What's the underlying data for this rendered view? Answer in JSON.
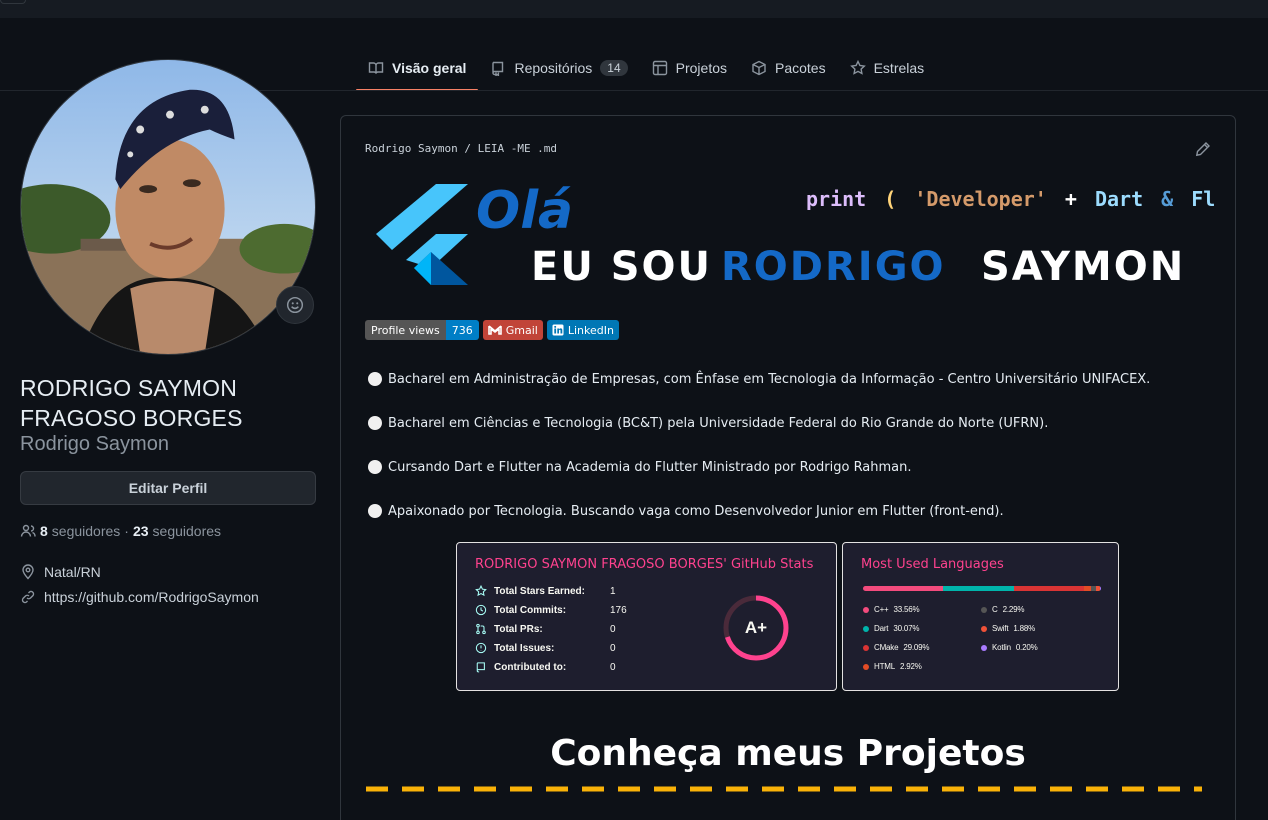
{
  "tabs": [
    {
      "label": "Visão geral",
      "active": true
    },
    {
      "label": "Repositórios",
      "count": "14"
    },
    {
      "label": "Projetos"
    },
    {
      "label": "Pacotes"
    },
    {
      "label": "Estrelas"
    }
  ],
  "profile": {
    "fullname": "RODRIGO SAYMON FRAGOSO BORGES",
    "username": "Rodrigo Saymon",
    "edit_button": "Editar Perfil",
    "followers_count": "8",
    "followers_label": "seguidores",
    "separator": "·",
    "following_count": "23",
    "following_label": "seguidores",
    "location": "Natal/RN",
    "website": "https://github.com/RodrigoSaymon"
  },
  "readme": {
    "path": "Rodrigo Saymon / LEIA -ME .md",
    "banner": {
      "greeting": "Olá",
      "intro": "EU SOU",
      "name": "RODRIGO",
      "surname": "SAYMON",
      "code_print": "print",
      "code_open": "(",
      "code_string": "'Developer'",
      "code_plus": "+",
      "code_dart": "Dart",
      "code_amp": "&",
      "code_flutter": "Flutter",
      "code_close": ");"
    },
    "badges": {
      "views_label": "Profile views",
      "views_value": "736",
      "gmail": "Gmail",
      "linkedin": "LinkedIn"
    },
    "bullets": [
      "Bacharel em Administração de Empresas, com Ênfase em Tecnologia da Informação - Centro Universitário UNIFACEX.",
      "Bacharel em Ciências e Tecnologia (BC&T) pela Universidade Federal do Rio Grande do Norte (UFRN).",
      "Cursando Dart e Flutter na Academia do Flutter Ministrado por Rodrigo Rahman.",
      "Apaixonado por Tecnologia. Buscando vaga como Desenvolvedor Junior em Flutter (front-end)."
    ],
    "stats": {
      "title": "RODRIGO SAYMON FRAGOSO BORGES' GitHub Stats",
      "rows": [
        {
          "icon": "star-icon",
          "label": "Total Stars Earned:",
          "value": "1"
        },
        {
          "icon": "clock-icon",
          "label": "Total Commits:",
          "value": "176"
        },
        {
          "icon": "pull-request-icon",
          "label": "Total PRs:",
          "value": "0"
        },
        {
          "icon": "issue-icon",
          "label": "Total Issues:",
          "value": "0"
        },
        {
          "icon": "repo-icon",
          "label": "Contributed to:",
          "value": "0"
        }
      ],
      "rank": "A+",
      "rank_progress": 0.7
    },
    "languages": {
      "title": "Most Used Languages",
      "items": [
        {
          "name": "C++",
          "percent": "33.56%",
          "value": 33.56,
          "color": "#f34b7d"
        },
        {
          "name": "Dart",
          "percent": "30.07%",
          "value": 30.07,
          "color": "#00B4AB"
        },
        {
          "name": "CMake",
          "percent": "29.09%",
          "value": 29.09,
          "color": "#DA3434"
        },
        {
          "name": "HTML",
          "percent": "2.92%",
          "value": 2.92,
          "color": "#e34c26"
        },
        {
          "name": "C",
          "percent": "2.29%",
          "value": 2.29,
          "color": "#555555"
        },
        {
          "name": "Swift",
          "percent": "1.88%",
          "value": 1.88,
          "color": "#F05138"
        },
        {
          "name": "Kotlin",
          "percent": "0.20%",
          "value": 0.2,
          "color": "#A97BFF"
        }
      ]
    },
    "projects_heading": "Conheça meus Projetos"
  },
  "colors": {
    "accent": "#f78166",
    "dashes": "#f9b208"
  }
}
